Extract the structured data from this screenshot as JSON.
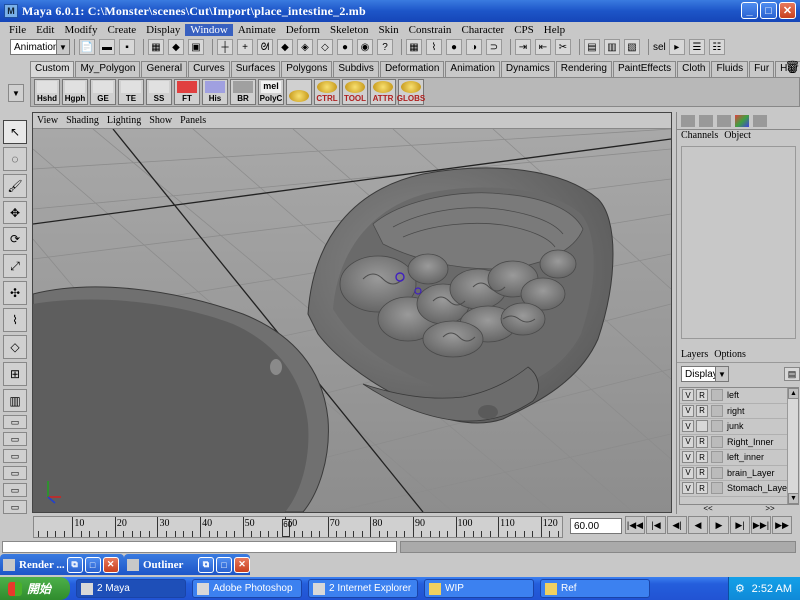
{
  "window": {
    "title": "Maya 6.0.1: C:\\Monster\\scenes\\Cut\\Import\\place_intestine_2.mb",
    "minimize_label": "_",
    "maximize_label": "□",
    "close_label": "✕"
  },
  "menus": [
    "File",
    "Edit",
    "Modify",
    "Create",
    "Display",
    "Window",
    "Animate",
    "Deform",
    "Skeleton",
    "Skin",
    "Constrain",
    "Character",
    "CPS",
    "Help"
  ],
  "active_menu": "Window",
  "statusline": {
    "mode": "Animation",
    "sel_label": "sel"
  },
  "shelf_tabs": [
    "Custom",
    "My_Polygon",
    "General",
    "Curves",
    "Surfaces",
    "Polygons",
    "Subdivs",
    "Deformation",
    "Animation",
    "Dynamics",
    "Rendering",
    "PaintEffects",
    "Cloth",
    "Fluids",
    "Fur",
    "Hair"
  ],
  "active_shelf_tab": "Custom",
  "shelf_buttons": [
    "Hshd",
    "Hgph",
    "GE",
    "TE",
    "SS",
    "FT",
    "His",
    "BR",
    "PolyC",
    "",
    "CTRL",
    "TOOL",
    "ATTR",
    "GLOBS"
  ],
  "shelf_top_labels": {
    "polyc": "mel"
  },
  "viewport": {
    "menus": [
      "View",
      "Shading",
      "Lighting",
      "Show",
      "Panels"
    ]
  },
  "channel_box": {
    "menus": [
      "Channels",
      "Object"
    ]
  },
  "layers": {
    "menus": [
      "Layers",
      "Options"
    ],
    "display": "Display",
    "items": [
      {
        "v": "V",
        "r": "R",
        "name": "left"
      },
      {
        "v": "V",
        "r": "R",
        "name": "right"
      },
      {
        "v": "V",
        "r": "",
        "name": "junk"
      },
      {
        "v": "V",
        "r": "R",
        "name": "Right_Inner"
      },
      {
        "v": "V",
        "r": "R",
        "name": "left_inner"
      },
      {
        "v": "V",
        "r": "R",
        "name": "brain_Layer"
      },
      {
        "v": "V",
        "r": "R",
        "name": "Stomach_Layer"
      }
    ],
    "nav_left": "<<",
    "nav_right": ">>"
  },
  "timeline": {
    "ticks": [
      "10",
      "20",
      "30",
      "40",
      "50",
      "60",
      "70",
      "80",
      "90",
      "100",
      "110",
      "120"
    ],
    "current_frame": "60",
    "current_frame_field": "60.00",
    "playback": [
      "|◀◀",
      "|◀",
      "◀|",
      "◀",
      "▶",
      "▶|",
      "▶▶|",
      "▶▶"
    ]
  },
  "minimized_windows": [
    {
      "title": "Render ..."
    },
    {
      "title": "Outliner"
    }
  ],
  "taskbar": {
    "start_label": "開始",
    "items": [
      {
        "label": "2 Maya"
      },
      {
        "label": "Adobe Photoshop"
      },
      {
        "label": "2 Internet Explorer"
      },
      {
        "label": "WIP"
      },
      {
        "label": "Ref"
      }
    ],
    "clock": "2:52 AM"
  },
  "colors": {
    "titlebar": "#1d55c8",
    "viewport_bg": "#9d9d9d",
    "taskbar": "#245edc",
    "start_button": "#2f8c2d"
  }
}
